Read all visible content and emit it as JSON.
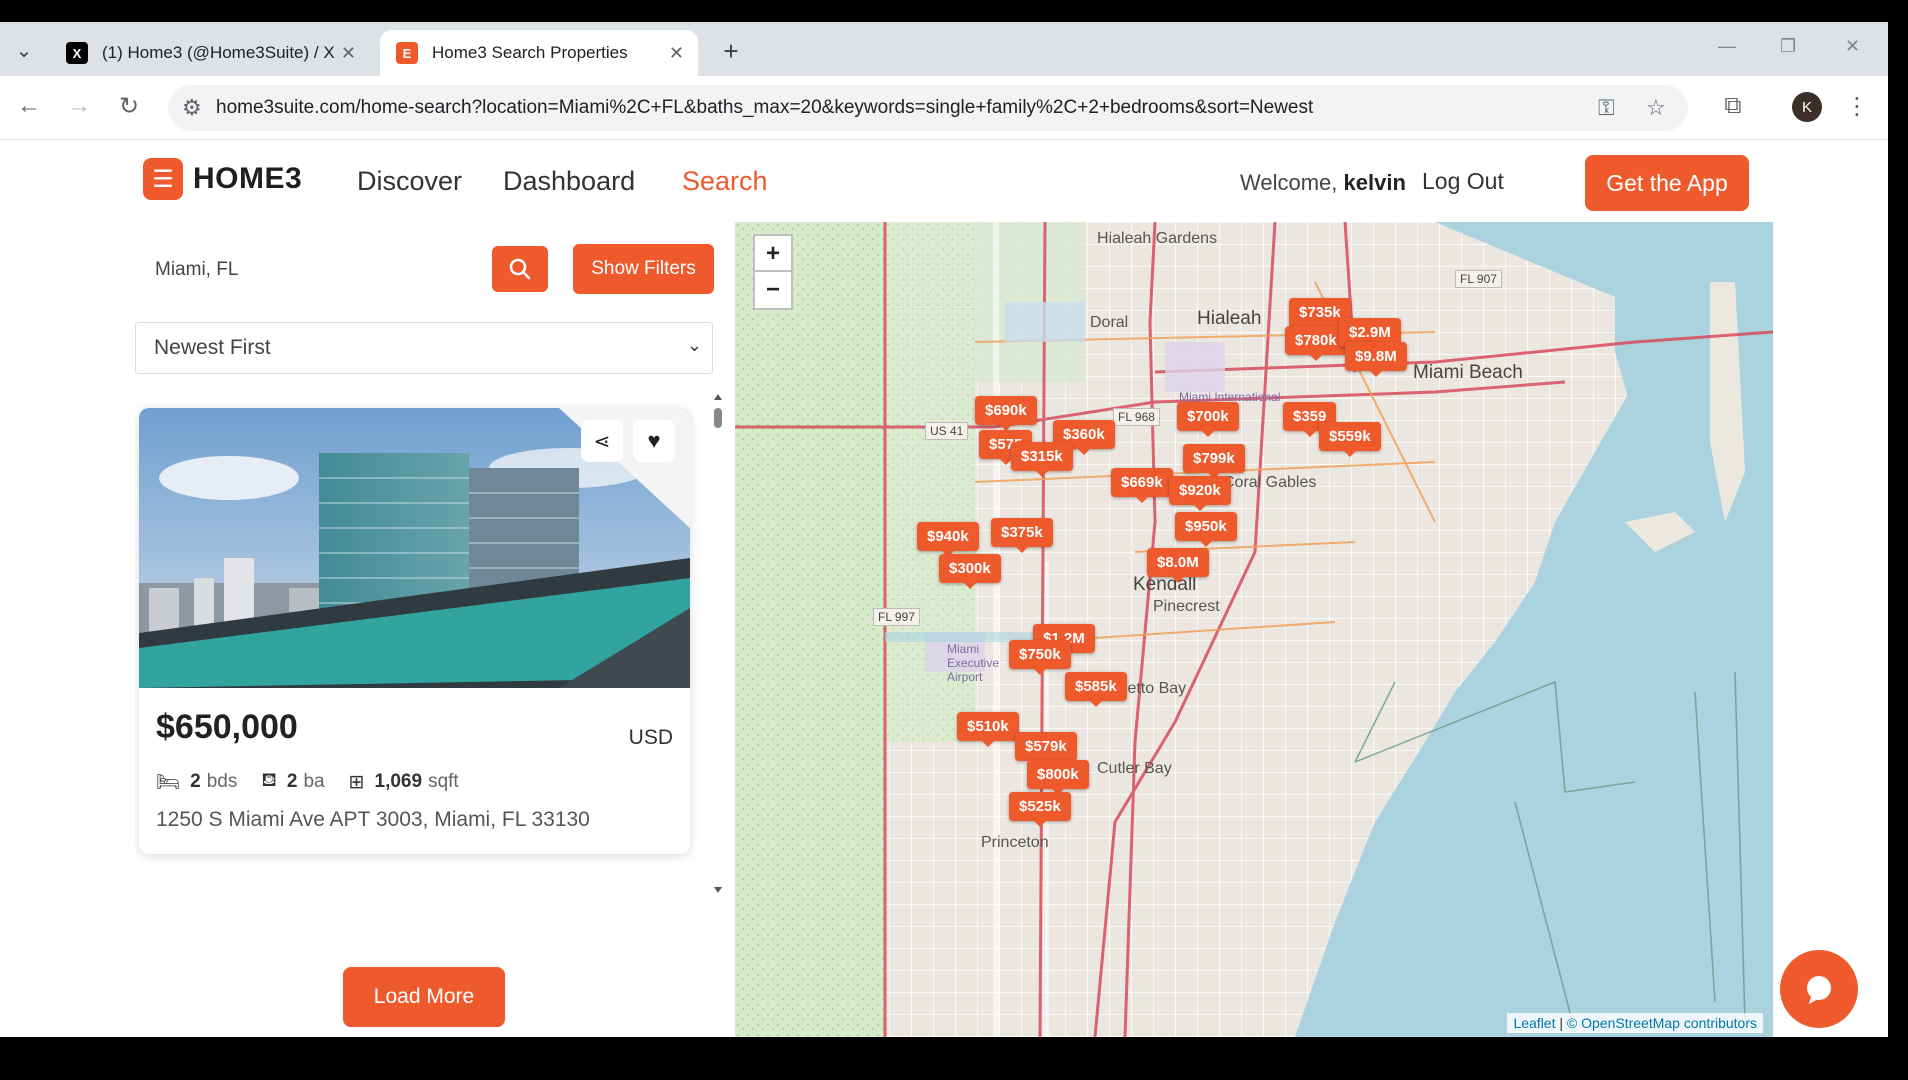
{
  "browser": {
    "tabs": [
      {
        "title": "(1) Home3 (@Home3Suite) / X",
        "favicon": "x-logo-icon",
        "active": false
      },
      {
        "title": "Home3 Search Properties",
        "favicon": "home3-favicon-icon",
        "active": true
      }
    ],
    "url": "home3suite.com/home-search?location=Miami%2C+FL&baths_max=20&keywords=single+family%2C+2+bedrooms&sort=Newest",
    "profile_initial": "K"
  },
  "header": {
    "logo_text": "HOME3",
    "nav": [
      {
        "label": "Discover",
        "active": false
      },
      {
        "label": "Dashboard",
        "active": false
      },
      {
        "label": "Search",
        "active": true
      }
    ],
    "welcome_prefix": "Welcome,",
    "welcome_user": "kelvin",
    "logout_label": "Log Out",
    "get_app_label": "Get the App"
  },
  "search": {
    "location_value": "Miami, FL",
    "show_filters_label": "Show Filters",
    "sort_value": "Newest First"
  },
  "listing": {
    "price": "$650,000",
    "currency": "USD",
    "beds": "2",
    "beds_unit": "bds",
    "baths": "2",
    "baths_unit": "ba",
    "sqft": "1,069",
    "sqft_unit": "sqft",
    "address": "1250 S Miami Ave APT 3003, Miami, FL 33130"
  },
  "load_more_label": "Load More",
  "map": {
    "zoom_in": "+",
    "zoom_out": "−",
    "places": [
      "Hialeah Gardens",
      "Hialeah",
      "Doral",
      "Miami Beach",
      "Coral Gables",
      "Kendall",
      "Pinecrest",
      "Cutler Bay",
      "Princeton",
      "Palmetto Bay",
      "Miami International",
      "Miami Executive Airport"
    ],
    "road_labels": [
      "US 41",
      "FL 968",
      "FL 997",
      "FL 907"
    ],
    "price_pins": [
      "$735k",
      "$780k",
      "$2.9M",
      "$9.8M",
      "$690k",
      "$700k",
      "$359",
      "$559k",
      "$575",
      "$360k",
      "$315k",
      "$799k",
      "$669k",
      "$920k",
      "$940k",
      "$375k",
      "$950k",
      "$300k",
      "$8.0M",
      "$1.2M",
      "$750k",
      "$585k",
      "$510k",
      "$579k",
      "$800k",
      "$525k"
    ],
    "attribution_leaflet": "Leaflet",
    "attribution_osm": "© OpenStreetMap contributors"
  },
  "colors": {
    "brand": "#ef5a2d",
    "water": "#aad3df",
    "park": "#c8e6b4"
  }
}
